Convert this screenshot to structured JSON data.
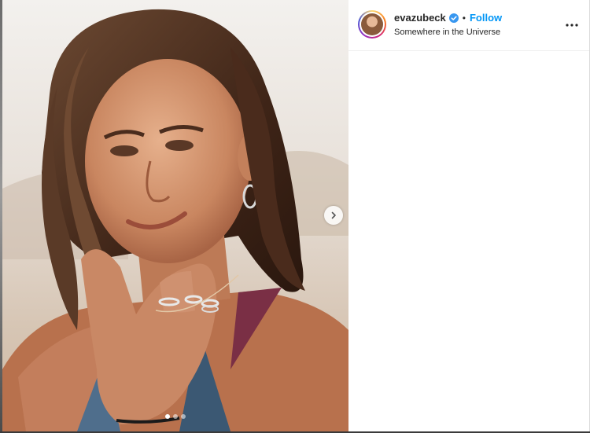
{
  "post": {
    "username": "evazubeck",
    "separator": "•",
    "follow_label": "Follow",
    "location": "Somewhere in the Universe",
    "verified_icon": "verified-badge-icon",
    "more_icon": "more-horizontal-icon",
    "next_icon": "chevron-right-icon"
  },
  "carousel": {
    "slide_count": 3,
    "active_index": 0
  },
  "colors": {
    "link_blue": "#0095f6",
    "text": "#262626",
    "border": "#dbdbdb"
  }
}
